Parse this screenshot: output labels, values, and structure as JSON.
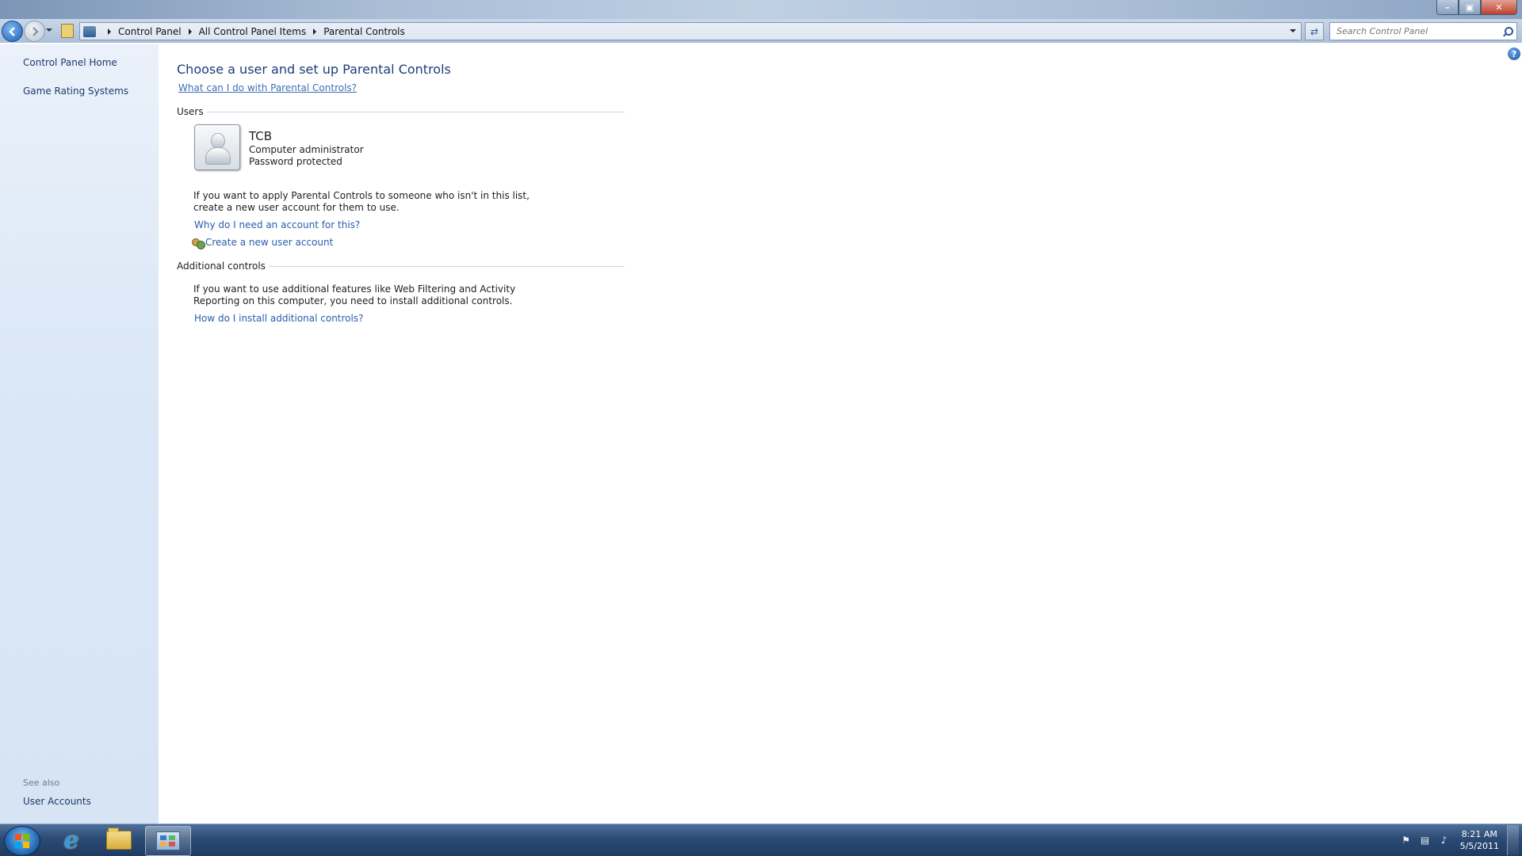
{
  "window": {
    "minimize_glyph": "–",
    "maximize_glyph": "▣",
    "close_glyph": "✕"
  },
  "navbar": {
    "breadcrumb": [
      "Control Panel",
      "All Control Panel Items",
      "Parental Controls"
    ],
    "refresh_glyph": "⇄",
    "search_placeholder": "Search Control Panel"
  },
  "sidebar": {
    "links": [
      "Control Panel Home",
      "Game Rating Systems"
    ],
    "see_also_label": "See also",
    "see_also_links": [
      "User Accounts"
    ]
  },
  "main": {
    "help_glyph": "?",
    "title": "Choose a user and set up Parental Controls",
    "help_link": "What can I do with Parental Controls?",
    "users_section": {
      "label": "Users",
      "user": {
        "name": "TCB",
        "role": "Computer administrator",
        "status": "Password protected"
      },
      "info_line1": "If you want to apply Parental Controls to someone who isn't in this list,",
      "info_line2": "create a new user account for them to use.",
      "why_link": "Why do I need an account for this?",
      "create_link": "Create a new user account"
    },
    "additional_section": {
      "label": "Additional controls",
      "info_line1": "If you want to use additional features like Web Filtering and Activity",
      "info_line2": "Reporting on this computer, you need to install additional controls.",
      "install_link": "How do I install additional controls?"
    }
  },
  "taskbar": {
    "ie_glyph": "e",
    "tray_icons": [
      "flag-icon",
      "network-icon",
      "volume-icon"
    ],
    "flag_glyph": "⚑",
    "network_glyph": "▤",
    "volume_glyph": "♪",
    "time": "8:21 AM",
    "date": "5/5/2011"
  },
  "colors": {
    "link": "#2a5db0",
    "title": "#1e3c7a",
    "sidebar_link": "#1e3a6c",
    "sidebar_bg": "#dbe8f6"
  }
}
